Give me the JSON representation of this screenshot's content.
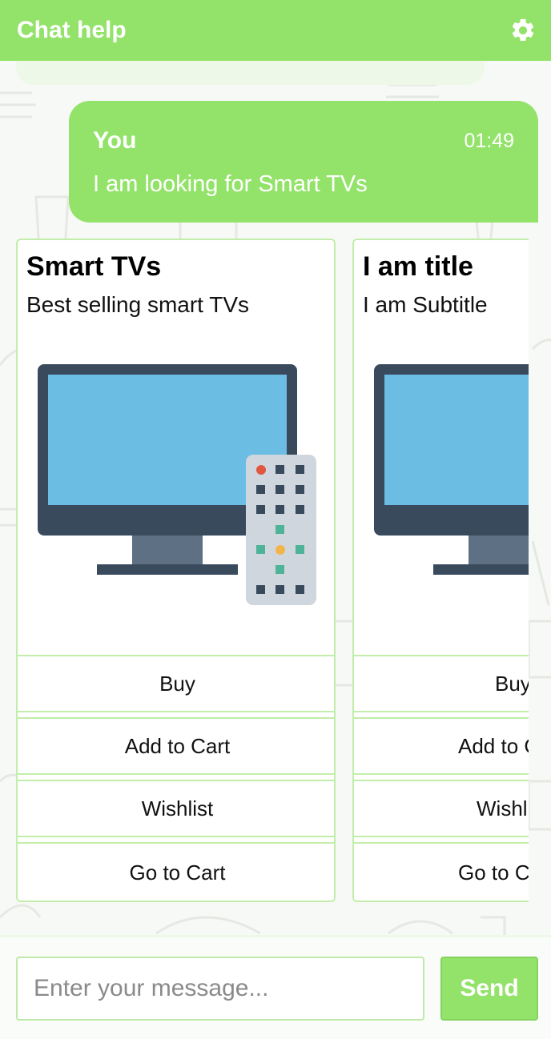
{
  "header": {
    "title": "Chat help",
    "settings_icon": "gear-icon"
  },
  "message": {
    "sender": "You",
    "time": "01:49",
    "text": "I am looking for Smart TVs"
  },
  "cards": [
    {
      "title": "Smart TVs",
      "subtitle": "Best selling smart TVs",
      "image": "tv-with-remote",
      "buttons": [
        "Buy",
        "Add to Cart",
        "Wishlist",
        "Go to Cart"
      ]
    },
    {
      "title": "I am title",
      "subtitle": "I am Subtitle",
      "image": "tv-with-remote",
      "buttons": [
        "Buy",
        "Add to Cart",
        "Wishlist",
        "Go to Cart"
      ]
    }
  ],
  "composer": {
    "placeholder": "Enter your message...",
    "send_label": "Send"
  },
  "colors": {
    "accent": "#93e36a",
    "card_border": "#c2eeaa",
    "screen": "#6bbde3",
    "tv_frame": "#3a4a5d"
  }
}
